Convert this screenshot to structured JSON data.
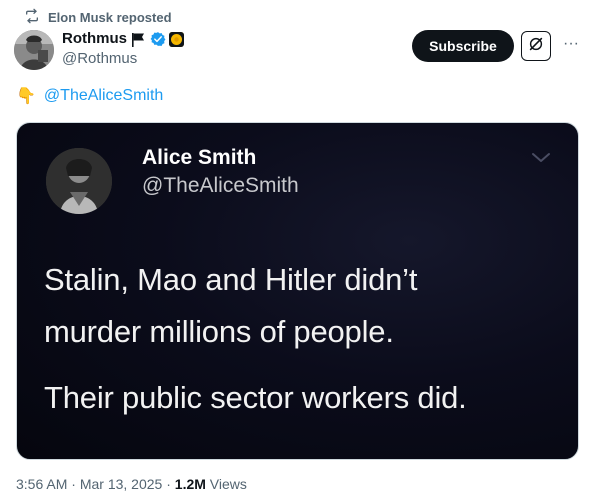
{
  "repost": {
    "icon": "repost-icon",
    "text": "Elon Musk reposted"
  },
  "author": {
    "name": "Rothmus",
    "handle": "@Rothmus",
    "badges": [
      "flag-icon",
      "verified-icon",
      "affiliation-badge-icon"
    ],
    "verified_color": "#1d9bf0"
  },
  "actions": {
    "subscribe_label": "Subscribe",
    "grok_icon": "grok-icon",
    "more_icon": "more-icon",
    "more_label": "···"
  },
  "tweet": {
    "emoji": "👇",
    "mention": "@TheAliceSmith",
    "mention_color": "#1d9bf0"
  },
  "media": {
    "quoted_name": "Alice Smith",
    "quoted_handle": "@TheAliceSmith",
    "lines": [
      "Stalin, Mao and Hitler didn’t",
      "murder millions of people.",
      "Their public sector workers did."
    ],
    "chevron_icon": "chevron-down-icon",
    "background_color": "#0b0c1b"
  },
  "footer": {
    "time": "3:56 AM",
    "sep1": " · ",
    "date": "Mar 13, 2025",
    "sep2": " · ",
    "views_count": "1.2M",
    "views_label": " Views"
  }
}
